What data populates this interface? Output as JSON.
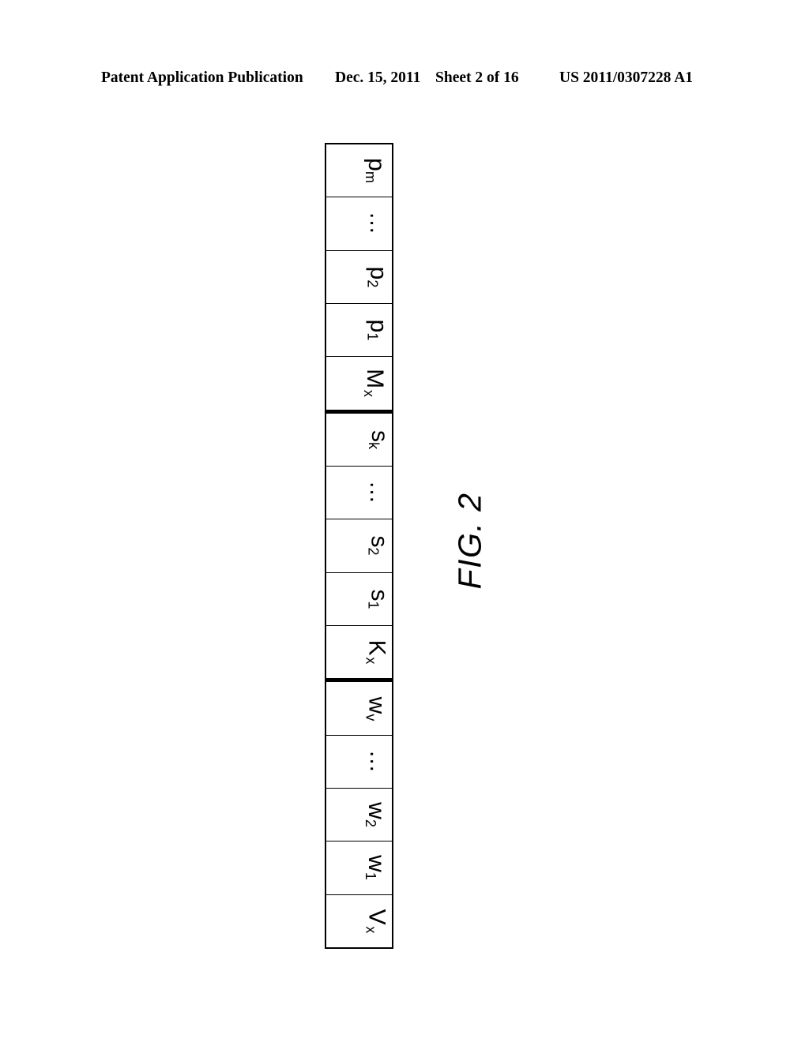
{
  "header": {
    "publication": "Patent Application Publication",
    "date": "Dec. 15, 2011",
    "sheet": "Sheet 2 of 16",
    "doc_number": "US 2011/0307228 A1"
  },
  "figure": {
    "caption": "FIG. 2",
    "type": "memory-layout-diagram",
    "orientation": "rotated-90",
    "colors": {
      "ink": "#000000",
      "paper": "#ffffff"
    },
    "groups": [
      {
        "group_name": "m-section",
        "cells": [
          {
            "base": "p",
            "sub": "m",
            "style": "normal",
            "full": "p_m"
          },
          {
            "base": "",
            "sub": "",
            "style": "ellipsis",
            "full": "..."
          },
          {
            "base": "p",
            "sub": "2",
            "style": "normal",
            "full": "p_2"
          },
          {
            "base": "p",
            "sub": "1",
            "style": "normal",
            "full": "p_1"
          },
          {
            "base": "M",
            "sub": "x",
            "style": "spaced",
            "full": "M_x"
          }
        ]
      },
      {
        "group_name": "k-section",
        "cells": [
          {
            "base": "s",
            "sub": "k",
            "style": "normal",
            "full": "s_k"
          },
          {
            "base": "",
            "sub": "",
            "style": "ellipsis",
            "full": "..."
          },
          {
            "base": "s",
            "sub": "2",
            "style": "normal",
            "full": "s_2"
          },
          {
            "base": "s",
            "sub": "1",
            "style": "normal",
            "full": "s_1"
          },
          {
            "base": "K",
            "sub": "x",
            "style": "spaced",
            "full": "K_x"
          }
        ]
      },
      {
        "group_name": "v-section",
        "cells": [
          {
            "base": "w",
            "sub": "v",
            "style": "normal",
            "full": "w_v"
          },
          {
            "base": "",
            "sub": "",
            "style": "ellipsis",
            "full": "..."
          },
          {
            "base": "w",
            "sub": "2",
            "style": "normal",
            "full": "w_2"
          },
          {
            "base": "w",
            "sub": "1",
            "style": "normal",
            "full": "w_1"
          },
          {
            "base": "V",
            "sub": "x",
            "style": "spaced",
            "full": "V_x"
          }
        ]
      }
    ]
  }
}
